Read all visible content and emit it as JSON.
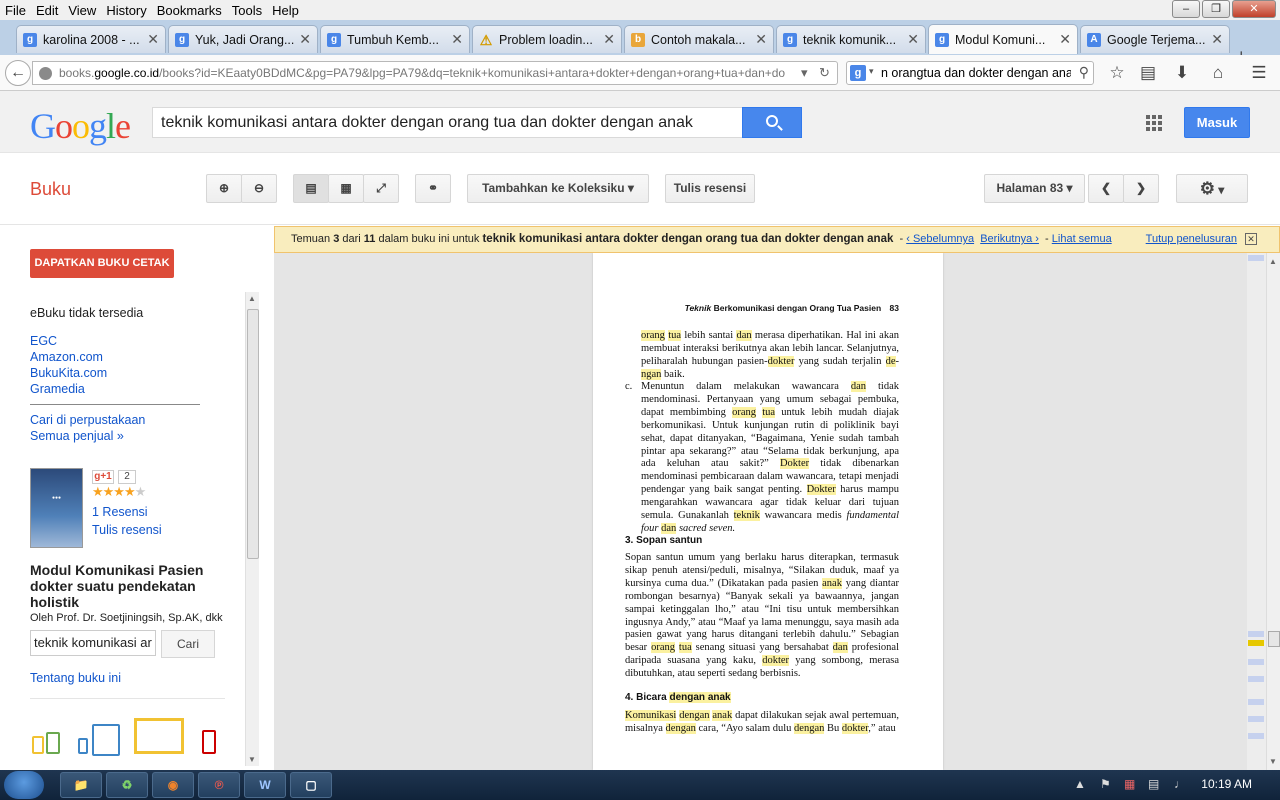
{
  "menubar": {
    "items": [
      "File",
      "Edit",
      "View",
      "History",
      "Bookmarks",
      "Tools",
      "Help"
    ]
  },
  "tabs": [
    {
      "label": "karolina 2008 - ...",
      "icon": "g-icon"
    },
    {
      "label": "Yuk, Jadi Orang...",
      "icon": "g-icon"
    },
    {
      "label": "Tumbuh Kemb...",
      "icon": "g-icon"
    },
    {
      "label": "Problem loadin...",
      "icon": "warning-icon"
    },
    {
      "label": "Contoh makala...",
      "icon": "blog-icon"
    },
    {
      "label": "teknik komunik...",
      "icon": "g-icon"
    },
    {
      "label": "Modul Komuni...",
      "icon": "g-icon",
      "active": true
    },
    {
      "label": "Google Terjema...",
      "icon": "translate-icon"
    }
  ],
  "nav": {
    "url_prefix": "books.",
    "url_domain": "google.co.id",
    "url_rest": "/books?id=KEaaty0BDdMC&pg=PA79&lpg=PA79&dq=teknik+komunikasi+antara+dokter+dengan+orang+tua+dan+do",
    "search_value": "n orangtua dan dokter dengan anak"
  },
  "google": {
    "logo": "Google",
    "query": "teknik komunikasi antara dokter dengan orang tua dan dokter dengan anak",
    "signin_label": "Masuk"
  },
  "books_toolbar": {
    "title": "Buku",
    "add_collection": "Tambahkan ke Koleksiku",
    "write_review": "Tulis resensi",
    "page_label": "Halaman 83"
  },
  "banner": {
    "prefix": "Temuan",
    "result_index": "3",
    "of": "dari",
    "result_total": "11",
    "middle": "dalam buku ini untuk",
    "query": "teknik komunikasi antara dokter dengan orang tua dan dokter dengan anak",
    "prev": "‹ Sebelumnya",
    "next": "Berikutnya ›",
    "see_all": "Lihat semua",
    "close_search": "Tutup penelusuran"
  },
  "left_panel": {
    "get_book": "DAPATKAN BUKU CETAK",
    "ebook_status": "eBuku tidak tersedia",
    "stores": [
      "EGC",
      "Amazon.com",
      "BukuKita.com",
      "Gramedia"
    ],
    "library": "Cari di perpustakaan",
    "all_sellers": "Semua penjual »",
    "gplus": "g+1",
    "gplus_count": "2",
    "rating_value": 4,
    "reviews": "1 Resensi",
    "write_review": "Tulis resensi",
    "book_title": "Modul Komunikasi Pasien dokter suatu pendekatan holistik",
    "author": "Oleh Prof. Dr. Soetjiningsih, Sp.AK, dkk",
    "inbook_query": "teknik komunikasi ar",
    "search_button": "Cari",
    "about": "Tentang buku ini"
  },
  "page": {
    "running_head_a": "Teknik",
    "running_head_b": "Berkomunikasi",
    "running_head_c": "dengan Orang Tua",
    "running_head_d": "Pasien",
    "page_number": "83",
    "section3": "3. Sopan santun",
    "section4_a": "4. Bicara",
    "section4_b": "dengan anak"
  },
  "taskbar": {
    "clock": "10:19 AM"
  }
}
